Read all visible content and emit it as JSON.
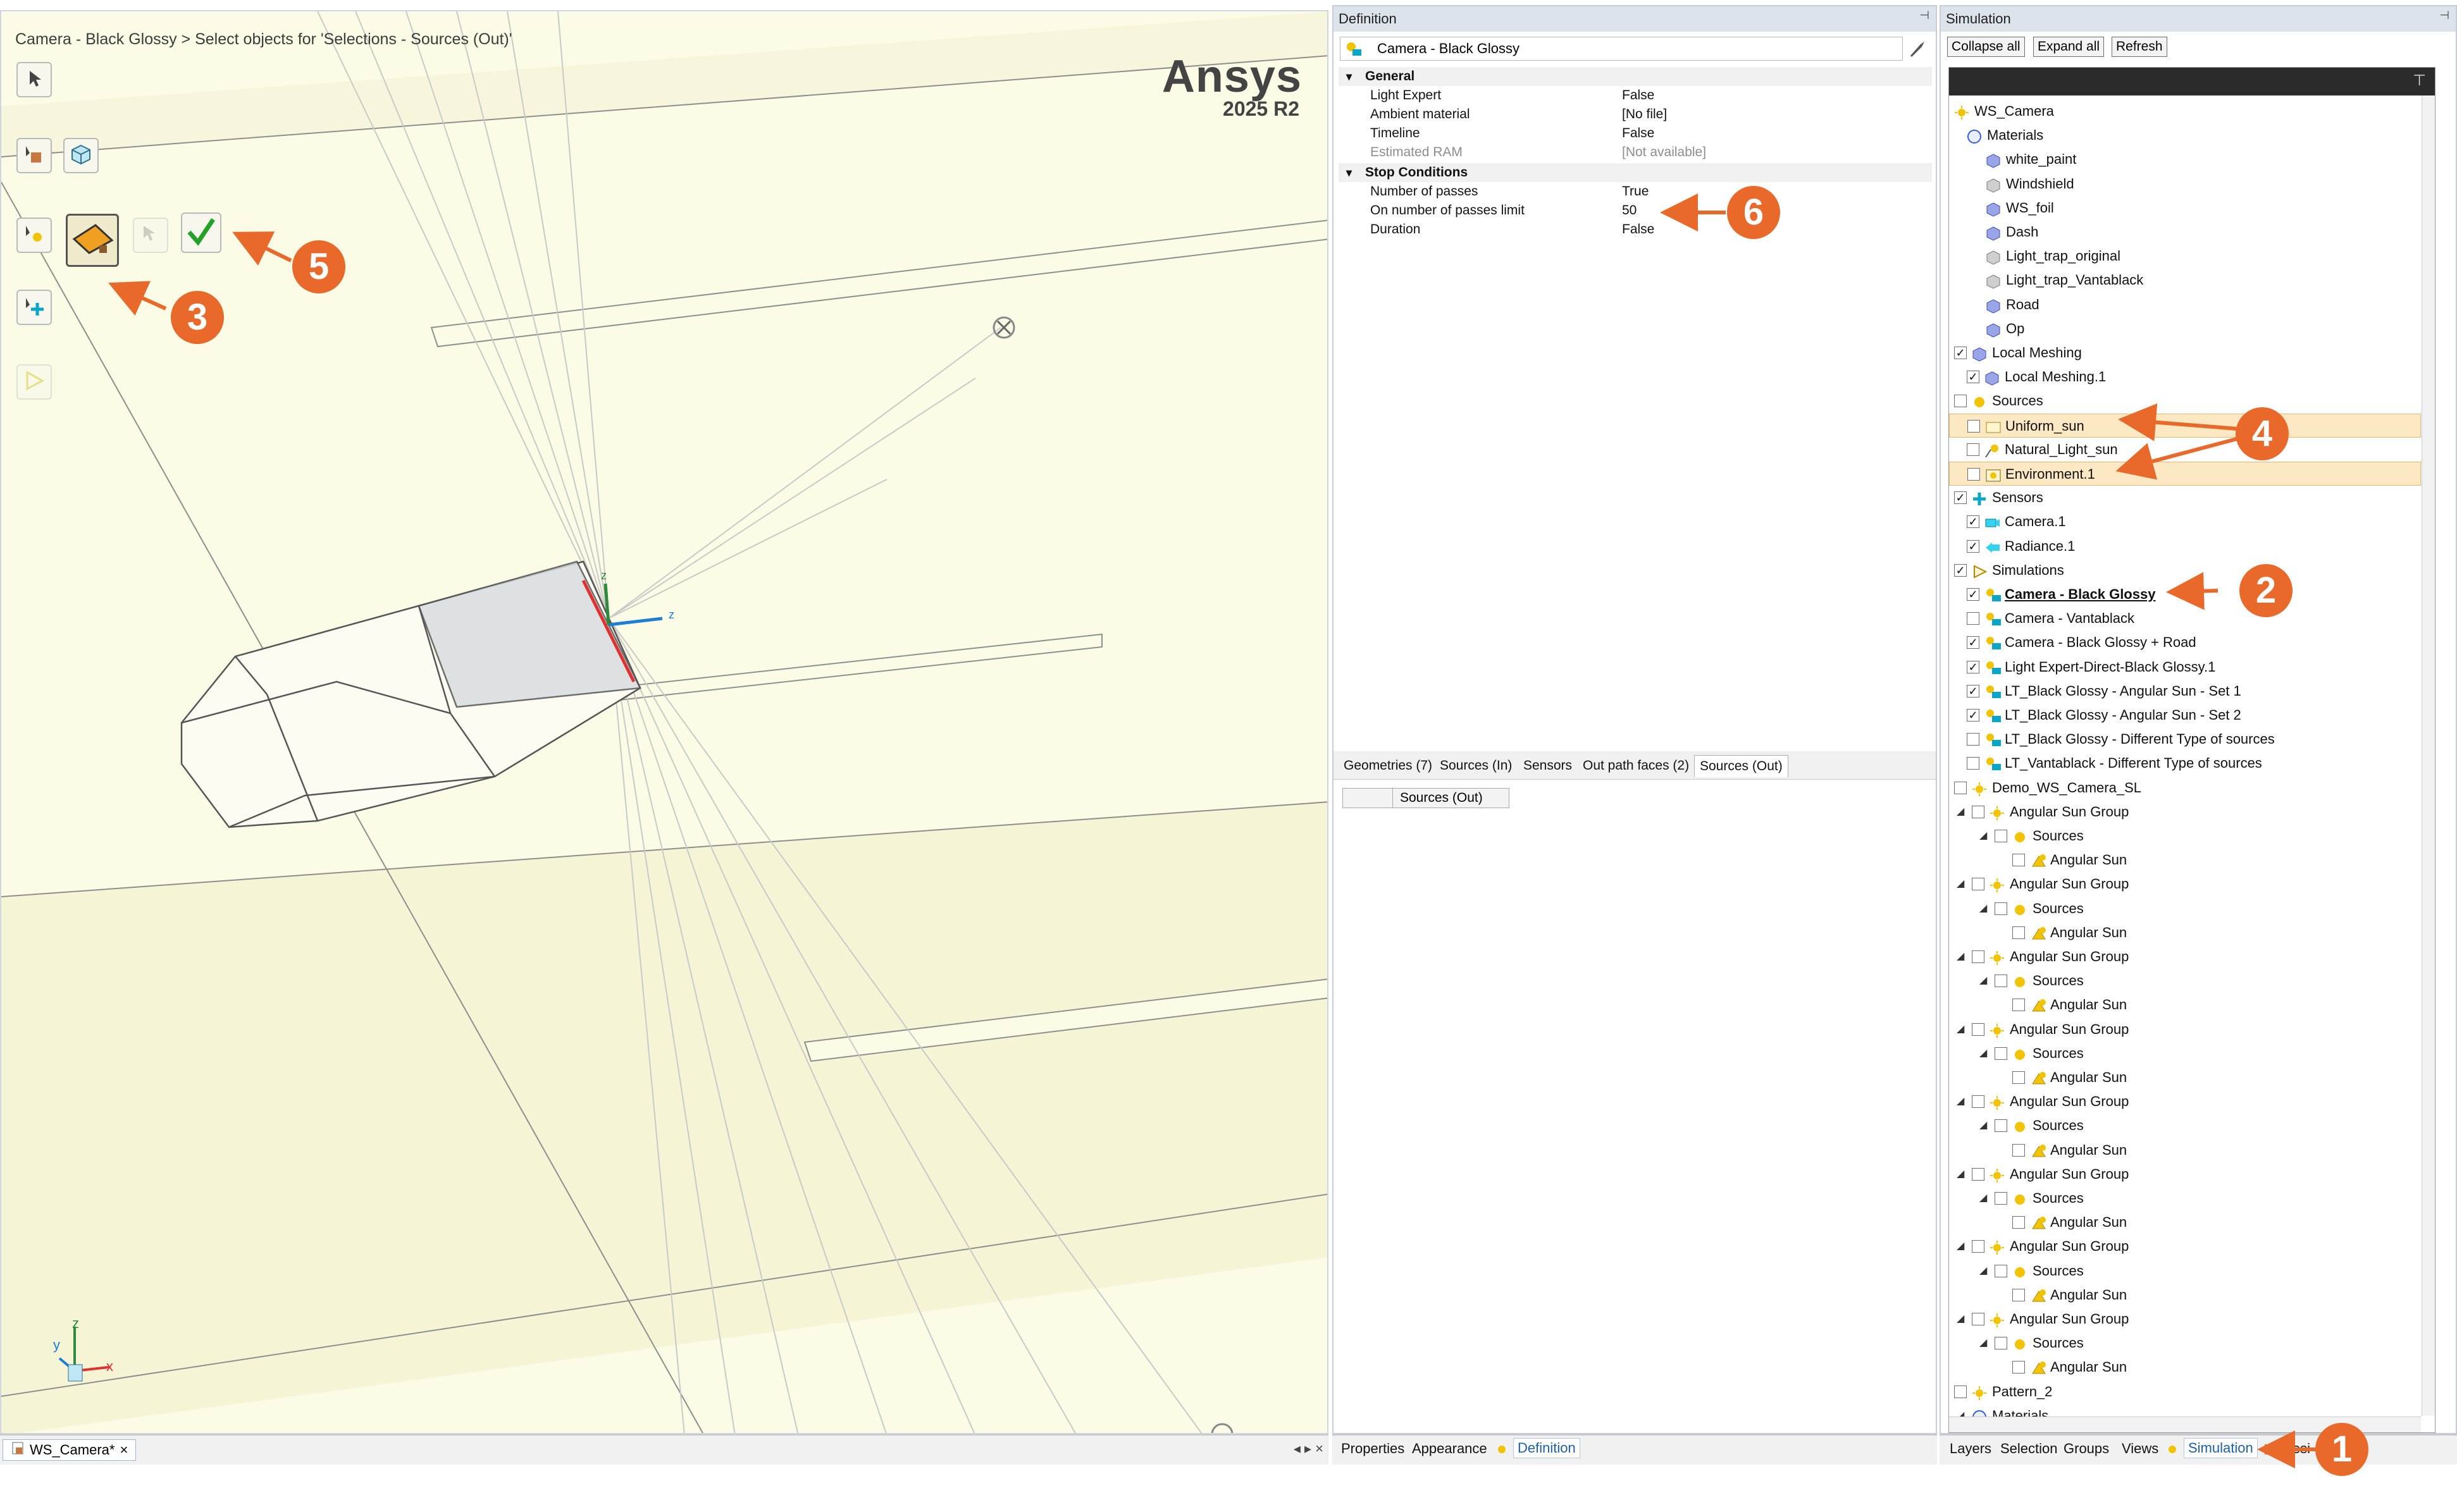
{
  "viewport": {
    "breadcrumb": "Camera -  Black Glossy > Select objects for 'Selections - Sources (Out)'",
    "logo_name": "Ansys",
    "logo_version": "2025 R2",
    "axis_labels": {
      "z": "z",
      "y": "y",
      "x": "x"
    }
  },
  "doc_tab": {
    "label": "WS_Camera*",
    "close": "×"
  },
  "definition": {
    "title": "Definition",
    "name": "Camera -  Black Glossy",
    "categories": [
      {
        "label": "General",
        "rows": [
          {
            "key": "Light Expert",
            "value": "False"
          },
          {
            "key": "Ambient material",
            "value": "[No file]"
          },
          {
            "key": "Timeline",
            "value": "False"
          },
          {
            "key": "Estimated RAM",
            "value": "[Not available]"
          }
        ]
      },
      {
        "label": "Stop Conditions",
        "rows": [
          {
            "key": "Number of passes",
            "value": "True"
          },
          {
            "key": "On number of passes limit",
            "value": "50"
          },
          {
            "key": "Duration",
            "value": "False"
          }
        ]
      }
    ],
    "lower_tabs": [
      "Geometries (7)",
      "Sources (In)",
      "Sensors",
      "Out path faces (2)",
      "Sources (Out)"
    ],
    "sources_header": "Sources (Out)",
    "bottom_tabs": [
      "Properties",
      "Appearance",
      "Definition"
    ]
  },
  "simulation": {
    "title": "Simulation",
    "buttons": [
      "Collapse all",
      "Expand all",
      "Refresh"
    ],
    "tree": [
      {
        "label": "WS_Camera"
      },
      {
        "label": "Materials"
      },
      {
        "label": "white_paint"
      },
      {
        "label": "Windshield"
      },
      {
        "label": "WS_foil"
      },
      {
        "label": "Dash"
      },
      {
        "label": "Light_trap_original"
      },
      {
        "label": "Light_trap_Vantablack"
      },
      {
        "label": "Road"
      },
      {
        "label": "Op"
      },
      {
        "label": "Local Meshing"
      },
      {
        "label": "Local Meshing.1"
      },
      {
        "label": "Sources"
      },
      {
        "label": "Uniform_sun"
      },
      {
        "label": "Natural_Light_sun"
      },
      {
        "label": "Environment.1"
      },
      {
        "label": "Sensors"
      },
      {
        "label": "Camera.1"
      },
      {
        "label": "Radiance.1"
      },
      {
        "label": "Simulations"
      },
      {
        "label": "Camera -  Black Glossy"
      },
      {
        "label": "Camera - Vantablack"
      },
      {
        "label": "Camera - Black Glossy + Road"
      },
      {
        "label": "Light Expert-Direct-Black Glossy.1"
      },
      {
        "label": "LT_Black Glossy - Angular Sun - Set 1"
      },
      {
        "label": "LT_Black Glossy - Angular Sun - Set 2"
      },
      {
        "label": "LT_Black Glossy - Different Type of sources"
      },
      {
        "label": "LT_Vantablack - Different Type of sources"
      },
      {
        "label": "Demo_WS_Camera_SL"
      },
      {
        "label": "Angular Sun Group"
      },
      {
        "label": "Sources"
      },
      {
        "label": "Angular Sun"
      },
      {
        "label": "Angular Sun Group"
      },
      {
        "label": "Sources"
      },
      {
        "label": "Angular Sun"
      },
      {
        "label": "Angular Sun Group"
      },
      {
        "label": "Sources"
      },
      {
        "label": "Angular Sun"
      },
      {
        "label": "Angular Sun Group"
      },
      {
        "label": "Sources"
      },
      {
        "label": "Angular Sun"
      },
      {
        "label": "Angular Sun Group"
      },
      {
        "label": "Sources"
      },
      {
        "label": "Angular Sun"
      },
      {
        "label": "Angular Sun Group"
      },
      {
        "label": "Sources"
      },
      {
        "label": "Angular Sun"
      },
      {
        "label": "Angular Sun Group"
      },
      {
        "label": "Sources"
      },
      {
        "label": "Angular Sun"
      },
      {
        "label": "Angular Sun Group"
      },
      {
        "label": "Sources"
      },
      {
        "label": "Angular Sun"
      },
      {
        "label": "Pattern_2"
      },
      {
        "label": "Materials"
      }
    ],
    "bottom_tabs": [
      "Layers",
      "Selection",
      "Groups",
      "Views",
      "Simulation",
      "Desi"
    ]
  },
  "callouts": [
    "1",
    "2",
    "3",
    "4",
    "5",
    "6"
  ],
  "colors": {
    "accent": "#e8692a",
    "viewport_bg": "#fbfbe6",
    "highlight": "#fde8c4"
  }
}
